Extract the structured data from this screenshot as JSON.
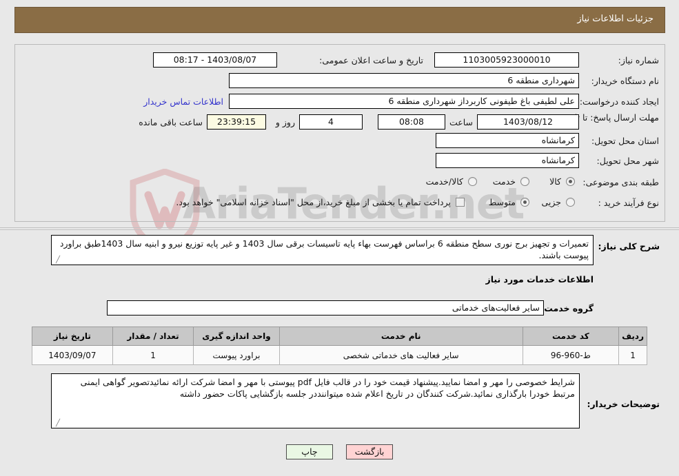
{
  "header": {
    "title": "جزئیات اطلاعات نیاز"
  },
  "form": {
    "need_number_label": "شماره نیاز:",
    "need_number_value": "1103005923000010",
    "announce_label": "تاریخ و ساعت اعلان عمومی:",
    "announce_value": "1403/08/07 - 08:17",
    "buyer_org_label": "نام دستگاه خریدار:",
    "buyer_org_value": "شهرداری منطقه 6",
    "requester_label": "ایجاد کننده درخواست:",
    "requester_value": "علی لطیفی باغ طیفونی کاربرداز شهرداری منطقه 6",
    "contact_link": "اطلاعات تماس خریدار",
    "deadline_label": "مهلت ارسال پاسخ: تا تاریخ:",
    "deadline_date": "1403/08/12",
    "hour_label": "ساعت",
    "deadline_time": "08:08",
    "days_value": "4",
    "days_label": "روز و",
    "countdown_value": "23:39:15",
    "remaining_label": "ساعت باقی مانده",
    "province_label": "استان محل تحویل:",
    "province_value": "کرمانشاه",
    "city_label": "شهر محل تحویل:",
    "city_value": "کرمانشاه",
    "category_label": "طبقه بندی موضوعی:",
    "category_options": [
      {
        "label": "کالا",
        "selected": false
      },
      {
        "label": "خدمت",
        "selected": true
      },
      {
        "label": "کالا/خدمت",
        "selected": false
      }
    ],
    "process_label": "نوع فرآیند خرید :",
    "process_options": [
      {
        "label": "جزیی",
        "selected": false
      },
      {
        "label": "متوسط",
        "selected": true
      }
    ],
    "treasury_checkbox_checked": false,
    "treasury_note": "پرداخت تمام یا بخشی از مبلغ خرید،از محل \"اسناد خزانه اسلامی\" خواهد بود."
  },
  "description": {
    "label": "شرح کلی نیاز:",
    "text": "تعمیرات و تجهیز برج نوری سطح منطقه 6 براساس فهرست بهاء پایه تاسیسات برقی سال 1403 و غیر پایه توزیع نیرو و ابنیه سال 1403طبق براورد پیوست باشند."
  },
  "services": {
    "section_title": "اطلاعات خدمات مورد نیاز",
    "group_label": "گروه خدمت:",
    "group_value": "سایر فعالیت‌های خدماتی",
    "columns": [
      "ردیف",
      "کد خدمت",
      "نام خدمت",
      "واحد اندازه گیری",
      "تعداد / مقدار",
      "تاریخ نیاز"
    ],
    "rows": [
      {
        "row": "1",
        "code": "ط-960-96",
        "name": "سایر فعالیت های خدماتی شخصی",
        "unit": "براورد پیوست",
        "quantity": "1",
        "date": "1403/09/07"
      }
    ]
  },
  "buyer_notes": {
    "label": "توضیحات خریدار:",
    "text": "شرایط خصوصی را مهر و امضا نمایید.پیشنهاد قیمت خود را در قالب فایل pdf پیوستی با مهر و امضا شرکت ارائه نمائیدتصویر گواهی ایمنی مرتبط خودرا بارگذاری نمائید.شرکت کنندگان در تاریخ اعلام شده میتواننددر جلسه بازگشایی پاکات حضور داشته"
  },
  "buttons": {
    "back": "بازگشت",
    "print": "چاپ"
  },
  "watermark": {
    "text": "AriaTender.net"
  },
  "colors": {
    "header_bg": "#8a6d45",
    "page_bg": "#e8e8e8",
    "link": "#3333cc",
    "back_btn": "#ffd3d3",
    "print_btn": "#e9f7e4",
    "table_header": "#c8c8c8",
    "countdown_bg": "#fcfbe3"
  }
}
